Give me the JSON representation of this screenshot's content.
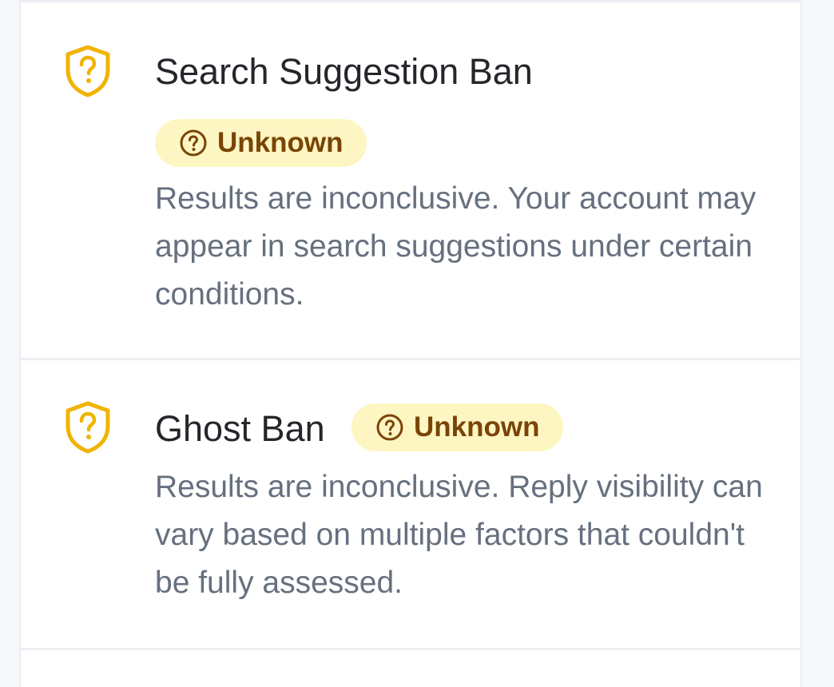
{
  "checks": [
    {
      "title": "Search Suggestion Ban",
      "status": "Unknown",
      "description": "Results are inconclusive. Your account may appear in search suggestions under certain conditions.",
      "icon": "shield-question-icon"
    },
    {
      "title": "Ghost Ban",
      "status": "Unknown",
      "description": "Results are inconclusive. Reply visibility can vary based on multiple factors that couldn't be fully assessed.",
      "icon": "shield-question-icon"
    }
  ],
  "colors": {
    "shield": "#f0b400",
    "badge_bg": "#fdf6c2",
    "badge_text": "#7a4407",
    "title": "#24262b",
    "description": "#66707e"
  }
}
